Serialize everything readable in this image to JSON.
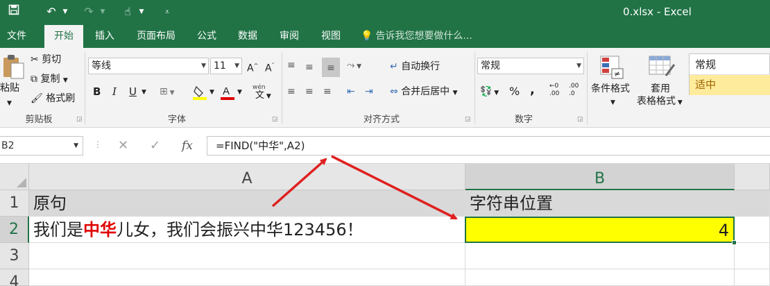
{
  "window": {
    "title": "0.xlsx - Excel"
  },
  "qat": {
    "save_icon": "save-icon",
    "undo_icon": "undo-icon",
    "redo_icon": "redo-icon",
    "touch_icon": "touch-mode-icon"
  },
  "tabs": [
    "文件",
    "开始",
    "插入",
    "页面布局",
    "公式",
    "数据",
    "审阅",
    "视图"
  ],
  "tell_me": "告诉我您想要做什么...",
  "ribbon": {
    "clipboard": {
      "paste": "粘贴",
      "cut": "剪切",
      "copy": "复制",
      "format_painter": "格式刷",
      "label": "剪贴板"
    },
    "font": {
      "name": "等线",
      "size": "11",
      "bold": "B",
      "italic": "I",
      "underline": "U",
      "phonetic": "wén",
      "label": "字体"
    },
    "alignment": {
      "wrap_text": "自动换行",
      "merge_center": "合并后居中",
      "label": "对齐方式"
    },
    "number": {
      "format": "常规",
      "percent": "%",
      "comma": ",",
      "inc_decimal": ".00",
      "dec_decimal": ".0",
      "label": "数字"
    },
    "styles": {
      "conditional_format": "条件格式",
      "table_format_1": "套用",
      "table_format_2": "表格格式",
      "style_normal": "常规",
      "style_neutral": "适中"
    }
  },
  "formula_bar": {
    "name_box": "B2",
    "fx": "fx",
    "formula": "=FIND(\"中华\",A2)"
  },
  "grid": {
    "columns": [
      "A",
      "B"
    ],
    "rows": [
      "1",
      "2",
      "3",
      "4"
    ],
    "cells": {
      "A1": "原句",
      "B1": "字符串位置",
      "A2_part1": "我们是",
      "A2_highlight": "中华",
      "A2_part2": "儿女，我们会振兴中华123456！",
      "B2": "4"
    }
  },
  "colors": {
    "accent": "#217346",
    "highlight_text": "#e00000",
    "active_cell_fill": "#ffff00",
    "annotation_arrow": "#e02020"
  }
}
